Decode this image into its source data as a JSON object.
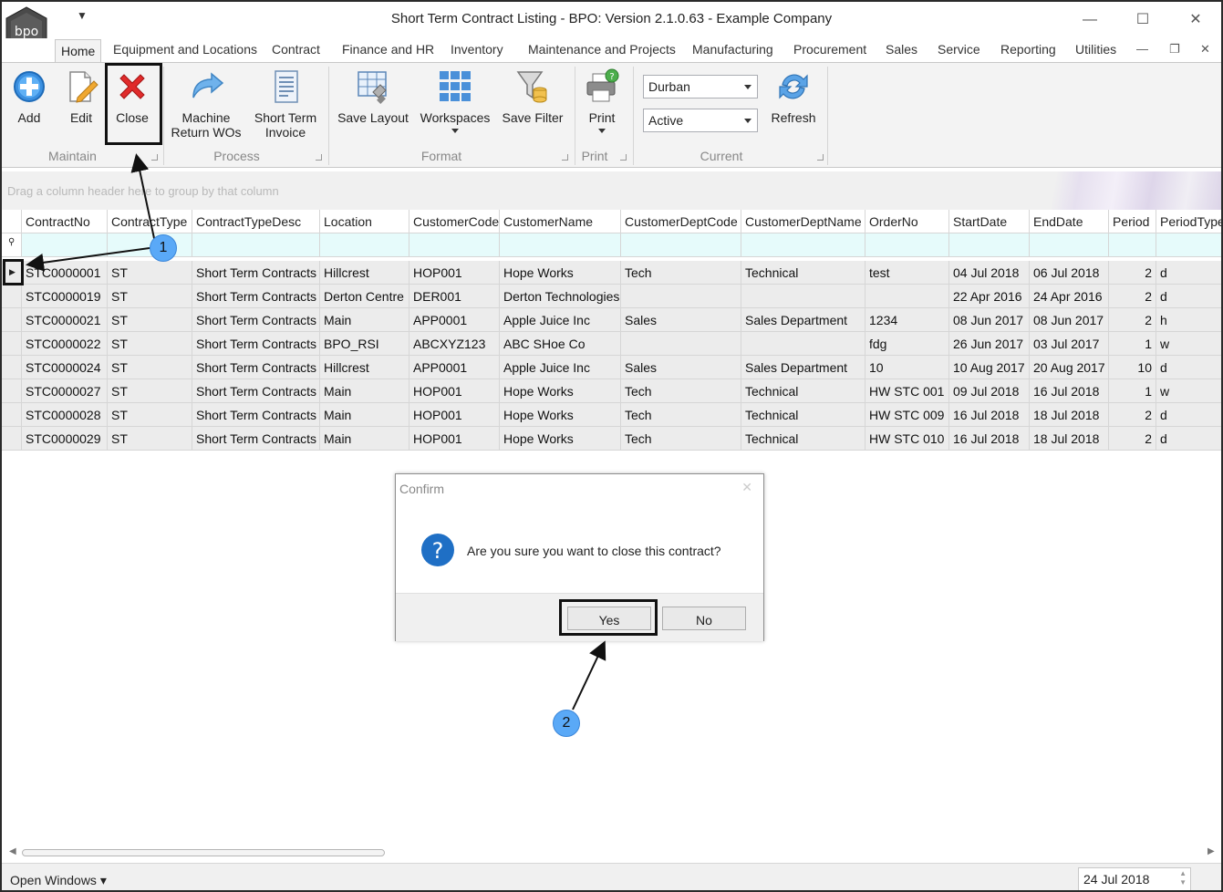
{
  "window": {
    "title": "Short Term Contract Listing - BPO: Version 2.1.0.63 - Example Company",
    "logo_text": "bpo",
    "controls": {
      "minimize": "—",
      "maximize": "☐",
      "close": "✕"
    }
  },
  "tabs": [
    {
      "label": "Home",
      "active": true
    },
    {
      "label": "Equipment and Locations"
    },
    {
      "label": "Contract"
    },
    {
      "label": "Finance and HR"
    },
    {
      "label": "Inventory"
    },
    {
      "label": "Maintenance and Projects"
    },
    {
      "label": "Manufacturing"
    },
    {
      "label": "Procurement"
    },
    {
      "label": "Sales"
    },
    {
      "label": "Service"
    },
    {
      "label": "Reporting"
    },
    {
      "label": "Utilities"
    }
  ],
  "ribbon": {
    "maintain": {
      "label": "Maintain",
      "add": "Add",
      "edit": "Edit",
      "close": "Close"
    },
    "process": {
      "label": "Process",
      "machine_return": "Machine\nReturn WOs",
      "short_term_invoice": "Short Term\nInvoice"
    },
    "format": {
      "label": "Format",
      "save_layout": "Save Layout",
      "workspaces": "Workspaces",
      "save_filter": "Save Filter"
    },
    "print": {
      "label": "Print",
      "print": "Print"
    },
    "current": {
      "label": "Current",
      "site": "Durban",
      "status": "Active",
      "refresh": "Refresh"
    }
  },
  "groupbar": {
    "hint": "Drag a column header here to group by that column"
  },
  "grid": {
    "columns": [
      "ContractNo",
      "ContractType",
      "ContractTypeDesc",
      "Location",
      "CustomerCode",
      "CustomerName",
      "CustomerDeptCode",
      "CustomerDeptName",
      "OrderNo",
      "StartDate",
      "EndDate",
      "Period",
      "PeriodType"
    ],
    "rows": [
      [
        "STC0000001",
        "ST",
        "Short Term Contracts",
        "Hillcrest",
        "HOP001",
        "Hope Works",
        "Tech",
        "Technical",
        "test",
        "04 Jul 2018",
        "06 Jul 2018",
        "2",
        "d"
      ],
      [
        "STC0000019",
        "ST",
        "Short Term Contracts",
        "Derton Centre",
        "DER001",
        "Derton Technologies",
        "",
        "",
        "",
        "22 Apr 2016",
        "24 Apr 2016",
        "2",
        "d"
      ],
      [
        "STC0000021",
        "ST",
        "Short Term Contracts",
        "Main",
        "APP0001",
        "Apple Juice Inc",
        "Sales",
        "Sales Department",
        "1234",
        "08 Jun 2017",
        "08 Jun 2017",
        "2",
        "h"
      ],
      [
        "STC0000022",
        "ST",
        "Short Term Contracts",
        "BPO_RSI",
        "ABCXYZ123",
        "ABC SHoe Co",
        "",
        "",
        "fdg",
        "26 Jun 2017",
        "03 Jul 2017",
        "1",
        "w"
      ],
      [
        "STC0000024",
        "ST",
        "Short Term Contracts",
        "Hillcrest",
        "APP0001",
        "Apple Juice Inc",
        "Sales",
        "Sales Department",
        "10",
        "10 Aug 2017",
        "20 Aug 2017",
        "10",
        "d"
      ],
      [
        "STC0000027",
        "ST",
        "Short Term Contracts",
        "Main",
        "HOP001",
        "Hope Works",
        "Tech",
        "Technical",
        "HW STC 001",
        "09 Jul 2018",
        "16 Jul 2018",
        "1",
        "w"
      ],
      [
        "STC0000028",
        "ST",
        "Short Term Contracts",
        "Main",
        "HOP001",
        "Hope Works",
        "Tech",
        "Technical",
        "HW STC 009",
        "16 Jul 2018",
        "18 Jul 2018",
        "2",
        "d"
      ],
      [
        "STC0000029",
        "ST",
        "Short Term Contracts",
        "Main",
        "HOP001",
        "Hope Works",
        "Tech",
        "Technical",
        "HW STC 010",
        "16 Jul 2018",
        "18 Jul 2018",
        "2",
        "d"
      ]
    ]
  },
  "dialog": {
    "title": "Confirm",
    "message": "Are you sure you want to close this contract?",
    "yes": "Yes",
    "no": "No"
  },
  "annotations": {
    "step1": "1",
    "step2": "2"
  },
  "statusbar": {
    "open_windows": "Open Windows ▾",
    "date": "24 Jul 2018"
  },
  "colors": {
    "accent": "#5aa9f7",
    "close_red": "#e02b2b",
    "filter_row": "#e6fbfb",
    "data_row": "#ececec"
  }
}
